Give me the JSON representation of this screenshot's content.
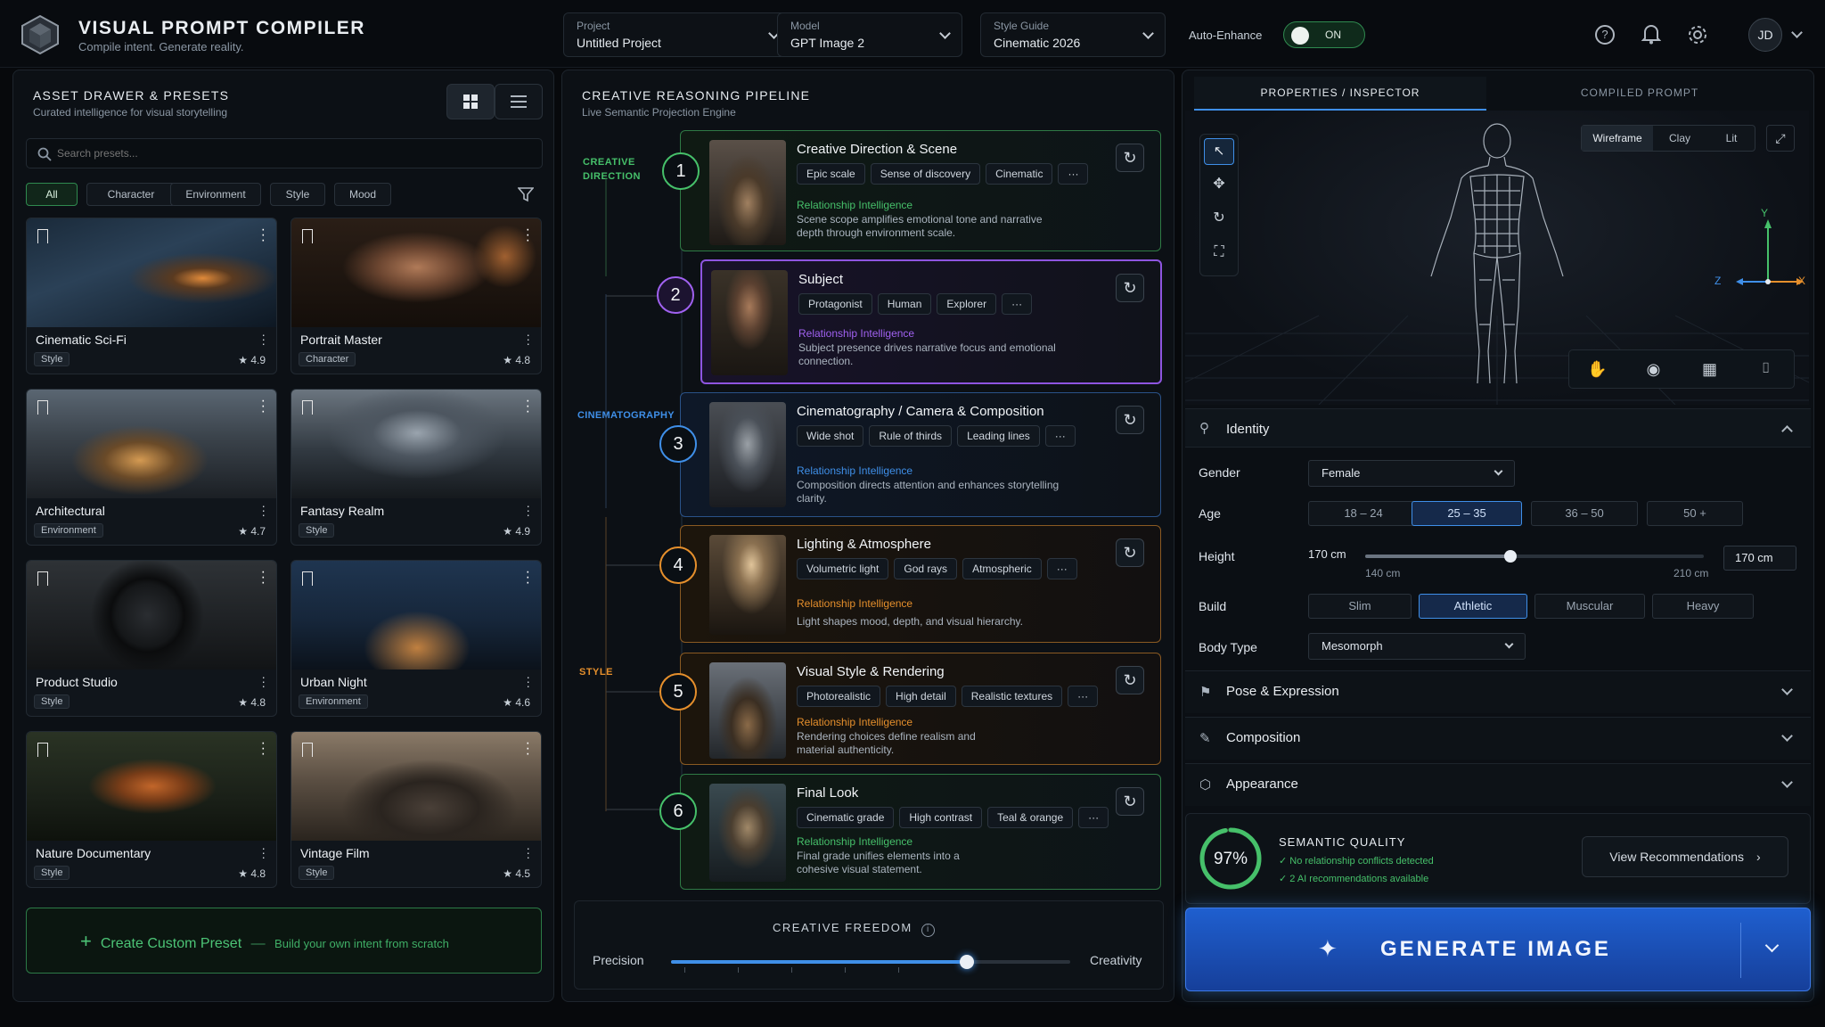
{
  "app": {
    "title": "VISUAL PROMPT COMPILER",
    "subtitle": "Compile intent. Generate reality."
  },
  "topbar": {
    "project": {
      "label": "Project",
      "value": "Untitled Project"
    },
    "model": {
      "label": "Model",
      "value": "GPT Image 2"
    },
    "style_guide": {
      "label": "Style Guide",
      "value": "Cinematic 2026"
    },
    "auto_enhance": {
      "label": "Auto-Enhance",
      "state": "ON"
    },
    "avatar": "JD"
  },
  "assets": {
    "title": "ASSET DRAWER & PRESETS",
    "subtitle": "Curated intelligence for visual storytelling",
    "search_placeholder": "Search presets...",
    "filters": [
      "All",
      "Character",
      "Environment",
      "Style",
      "Mood"
    ],
    "cards": [
      {
        "title": "Cinematic Sci-Fi",
        "tag": "Style",
        "rating": "4.9"
      },
      {
        "title": "Portrait Master",
        "tag": "Character",
        "rating": "4.8"
      },
      {
        "title": "Architectural",
        "tag": "Environment",
        "rating": "4.7"
      },
      {
        "title": "Fantasy Realm",
        "tag": "Style",
        "rating": "4.9"
      },
      {
        "title": "Product Studio",
        "tag": "Style",
        "rating": "4.8"
      },
      {
        "title": "Urban Night",
        "tag": "Environment",
        "rating": "4.6"
      },
      {
        "title": "Nature Documentary",
        "tag": "Style",
        "rating": "4.8"
      },
      {
        "title": "Vintage Film",
        "tag": "Style",
        "rating": "4.5"
      }
    ],
    "create": {
      "label": "Create Custom Preset",
      "sep": "—",
      "hint": "Build your own intent from scratch"
    }
  },
  "pipeline": {
    "title": "CREATIVE REASONING PIPELINE",
    "subtitle": "Live Semantic Projection Engine",
    "groups": [
      "CREATIVE DIRECTION",
      "CINEMATOGRAPHY",
      "STYLE"
    ],
    "ri_label": "Relationship Intelligence",
    "steps": [
      {
        "n": "1",
        "title": "Creative Direction & Scene",
        "chips": [
          "Epic scale",
          "Sense of discovery",
          "Cinematic",
          "···"
        ],
        "desc": "Scene scope amplifies emotional tone and narrative depth through environment scale.",
        "color": "#46c06a"
      },
      {
        "n": "2",
        "title": "Subject",
        "chips": [
          "Protagonist",
          "Human",
          "Explorer",
          "···"
        ],
        "desc": "Subject presence drives narrative focus and emotional connection.",
        "color": "#a061f0"
      },
      {
        "n": "3",
        "title": "Cinematography / Camera & Composition",
        "chips": [
          "Wide shot",
          "Rule of thirds",
          "Leading lines",
          "···"
        ],
        "desc": "Composition directs attention and enhances storytelling clarity.",
        "color": "#3f8fe8"
      },
      {
        "n": "4",
        "title": "Lighting & Atmosphere",
        "chips": [
          "Volumetric light",
          "God rays",
          "Atmospheric",
          "···"
        ],
        "desc": "Light shapes mood, depth, and visual hierarchy.",
        "color": "#e58f2c"
      },
      {
        "n": "5",
        "title": "Visual Style & Rendering",
        "chips": [
          "Photorealistic",
          "High detail",
          "Realistic textures",
          "···"
        ],
        "desc": "Rendering choices define realism and material authenticity.",
        "color": "#e58f2c"
      },
      {
        "n": "6",
        "title": "Final Look",
        "chips": [
          "Cinematic grade",
          "High contrast",
          "Teal & orange",
          "···"
        ],
        "desc": "Final grade unifies elements into a cohesive visual statement.",
        "color": "#46c06a"
      }
    ],
    "freedom": {
      "title": "CREATIVE FREEDOM",
      "left": "Precision",
      "right": "Creativity",
      "value": 0.74
    }
  },
  "inspector": {
    "tabs": [
      "PROPERTIES / INSPECTOR",
      "COMPILED PROMPT"
    ],
    "view_modes": [
      "Wireframe",
      "Clay",
      "Lit"
    ],
    "axes": {
      "x": "X",
      "y": "Y",
      "z": "Z"
    },
    "identity": "Identity",
    "gender": {
      "label": "Gender",
      "value": "Female"
    },
    "age": {
      "label": "Age",
      "options": [
        "18 – 24",
        "25 – 35",
        "36 – 50",
        "50 +"
      ],
      "selected": "25 – 35"
    },
    "height": {
      "label": "Height",
      "value": "170 cm",
      "min": "140 cm",
      "max": "210 cm",
      "box": "170 cm",
      "fraction": 0.43
    },
    "build": {
      "label": "Build",
      "options": [
        "Slim",
        "Athletic",
        "Muscular",
        "Heavy"
      ],
      "selected": "Athletic"
    },
    "body_type": {
      "label": "Body Type",
      "value": "Mesomorph"
    },
    "sections": [
      "Pose & Expression",
      "Composition",
      "Appearance"
    ],
    "quality": {
      "value": "97%",
      "title": "SEMANTIC QUALITY",
      "line1": "No relationship conflicts detected",
      "line2": "2 AI recommendations available",
      "button": "View Recommendations",
      "fraction": 0.97
    },
    "generate": "GENERATE IMAGE"
  }
}
